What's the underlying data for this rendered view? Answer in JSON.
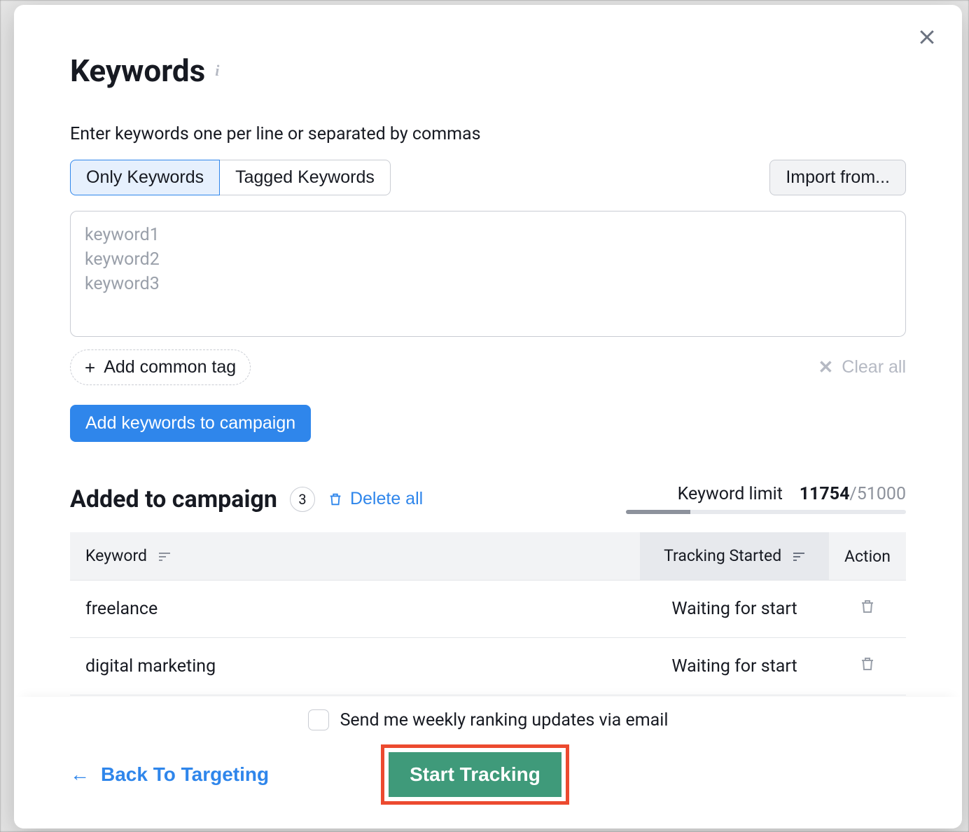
{
  "modal": {
    "title": "Keywords",
    "subtitle": "Enter keywords one per line or separated by commas",
    "close_aria": "Close"
  },
  "tabs": {
    "only": "Only Keywords",
    "tagged": "Tagged Keywords"
  },
  "import_button": "Import from...",
  "textarea": {
    "placeholder": "keyword1\nkeyword2\nkeyword3",
    "value": ""
  },
  "add_tag_button": "Add common tag",
  "clear_all": "Clear all",
  "add_keywords_button": "Add keywords to campaign",
  "campaign": {
    "title": "Added to campaign",
    "count": "3",
    "delete_all": "Delete all",
    "limit_label": "Keyword limit",
    "limit_used": "11754",
    "limit_total": "/51000"
  },
  "table": {
    "headers": {
      "keyword": "Keyword",
      "tracking": "Tracking Started",
      "action": "Action"
    },
    "rows": [
      {
        "keyword": "freelance",
        "tracking": "Waiting for start"
      },
      {
        "keyword": "digital marketing",
        "tracking": "Waiting for start"
      }
    ]
  },
  "footer": {
    "email_checkbox_label": "Send me weekly ranking updates via email",
    "back": "Back To Targeting",
    "start": "Start Tracking"
  }
}
